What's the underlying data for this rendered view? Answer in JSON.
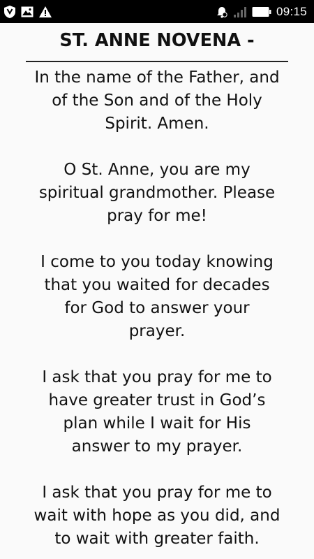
{
  "status_bar": {
    "time": "09:15",
    "left_icons": [
      "shield-app-icon",
      "image-notification-icon",
      "warning-icon"
    ],
    "right_icons": [
      "alarm-icon",
      "signal-icon",
      "battery-icon"
    ]
  },
  "novena": {
    "title": "ST. ANNE NOVENA -",
    "paragraphs": [
      [
        "In the name of the Father, and",
        "of the Son and of the Holy",
        "Spirit. Amen."
      ],
      [
        "O St. Anne, you are my",
        "spiritual grandmother. Please",
        "pray for me!"
      ],
      [
        "I come to you today knowing",
        "that you waited for decades",
        "for God to answer your",
        "prayer."
      ],
      [
        "I ask that you pray for me to",
        "have greater trust in God’s",
        "plan while I wait for His",
        "answer to my prayer."
      ],
      [
        "I ask that you pray for me to",
        "wait with hope as you did, and",
        "to wait with greater faith."
      ]
    ]
  }
}
